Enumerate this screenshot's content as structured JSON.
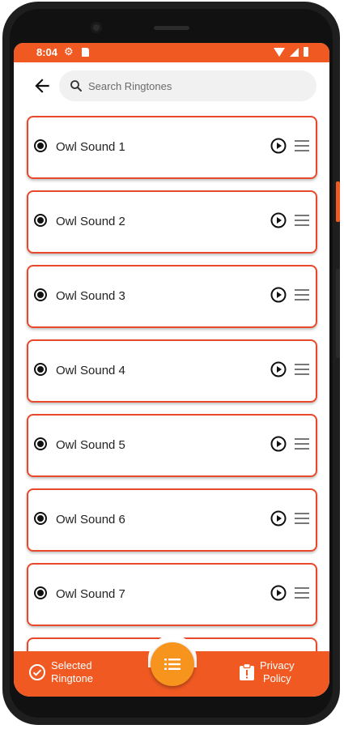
{
  "status_bar": {
    "time": "8:04",
    "icons": [
      "gear-icon",
      "sd-card-icon",
      "wifi-icon",
      "signal-icon",
      "battery-icon"
    ]
  },
  "header": {
    "back_icon": "arrow-left-icon",
    "search_placeholder": "Search Ringtones"
  },
  "ringtones": [
    {
      "label": "Owl Sound 1",
      "selected": true
    },
    {
      "label": "Owl Sound 2",
      "selected": true
    },
    {
      "label": "Owl Sound 3",
      "selected": true
    },
    {
      "label": "Owl Sound 4",
      "selected": true
    },
    {
      "label": "Owl Sound 5",
      "selected": true
    },
    {
      "label": "Owl Sound 6",
      "selected": true
    },
    {
      "label": "Owl Sound 7",
      "selected": true
    }
  ],
  "bottom_nav": {
    "selected_label_line1": "Selected",
    "selected_label_line2": "Ringtone",
    "privacy_label_line1": "Privacy",
    "privacy_label_line2": "Policy",
    "fab_icon": "list-icon"
  },
  "colors": {
    "accent": "#f05a22",
    "card_border": "#e8492b",
    "fab": "#f7941d"
  }
}
